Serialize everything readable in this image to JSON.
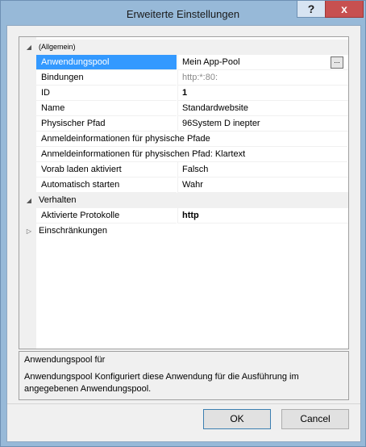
{
  "window": {
    "title": "Erweiterte Einstellungen",
    "help_label": "?",
    "close_label": "x"
  },
  "grid": {
    "categories": [
      {
        "label": "(Allgemein)",
        "expander": "◢"
      },
      {
        "label": "Verhalten",
        "expander": "◢"
      },
      {
        "label": "Einschränkungen",
        "expander": "▷"
      }
    ],
    "properties": [
      {
        "name": "Anwendungspool",
        "value": "Mein App-Pool",
        "ellipsis": "..."
      },
      {
        "name": "Bindungen",
        "value": "http:*:80:"
      },
      {
        "name": "ID",
        "value": "1"
      },
      {
        "name": "Name",
        "value": "Standardwebsite"
      },
      {
        "name": "Physischer Pfad",
        "value": "96System D inepter"
      },
      {
        "name": "Anmeldeinformationen für physische Pfade",
        "value": ""
      },
      {
        "name": "Anmeldeinformationen für physischen Pfad: Klartext",
        "value": ""
      },
      {
        "name": "Vorab laden aktiviert",
        "value": "Falsch"
      },
      {
        "name": "Automatisch starten",
        "value": "Wahr"
      },
      {
        "name": "Aktivierte Protokolle",
        "value": "http"
      }
    ]
  },
  "description": {
    "title": "Anwendungspool für",
    "text": "Anwendungspool Konfiguriert diese Anwendung für die Ausführung im angegebenen Anwendungspool."
  },
  "buttons": {
    "ok": "OK",
    "cancel": "Cancel"
  },
  "colors": {
    "selection": "#3399ff",
    "close": "#c75050",
    "frame": "#97b9d8"
  }
}
